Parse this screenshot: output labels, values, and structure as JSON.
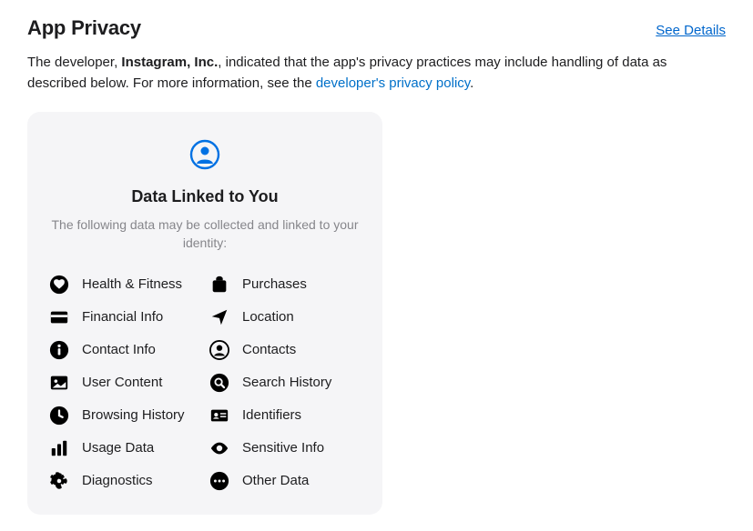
{
  "header": {
    "title": "App Privacy",
    "see_details": "See Details"
  },
  "description": {
    "prefix": "The developer, ",
    "developer": "Instagram, Inc.",
    "middle": ", indicated that the app's privacy practices may include handling of data as described below. For more information, see the ",
    "link": "developer's privacy policy",
    "suffix": "."
  },
  "card": {
    "title": "Data Linked to You",
    "subtitle": "The following data may be collected and linked to your identity:",
    "items_left": [
      {
        "icon": "health-fitness-icon",
        "label": "Health & Fitness"
      },
      {
        "icon": "financial-info-icon",
        "label": "Financial Info"
      },
      {
        "icon": "contact-info-icon",
        "label": "Contact Info"
      },
      {
        "icon": "user-content-icon",
        "label": "User Content"
      },
      {
        "icon": "browsing-history-icon",
        "label": "Browsing History"
      },
      {
        "icon": "usage-data-icon",
        "label": "Usage Data"
      },
      {
        "icon": "diagnostics-icon",
        "label": "Diagnostics"
      }
    ],
    "items_right": [
      {
        "icon": "purchases-icon",
        "label": "Purchases"
      },
      {
        "icon": "location-icon",
        "label": "Location"
      },
      {
        "icon": "contacts-icon",
        "label": "Contacts"
      },
      {
        "icon": "search-history-icon",
        "label": "Search History"
      },
      {
        "icon": "identifiers-icon",
        "label": "Identifiers"
      },
      {
        "icon": "sensitive-info-icon",
        "label": "Sensitive Info"
      },
      {
        "icon": "other-data-icon",
        "label": "Other Data"
      }
    ]
  }
}
